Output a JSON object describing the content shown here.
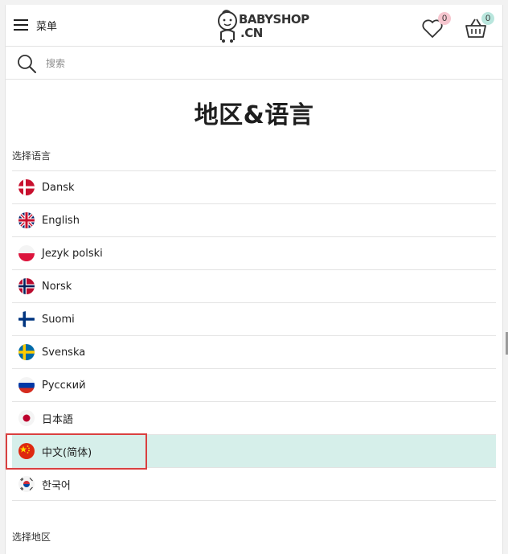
{
  "header": {
    "menu_label": "菜单",
    "logo_line1": "BABYSHOP",
    "logo_line2": ".CN",
    "wishlist_count": "0",
    "cart_count": "0",
    "wishlist_icon": "heart-icon",
    "cart_icon": "basket-icon"
  },
  "search": {
    "placeholder": "搜索",
    "icon": "search-icon"
  },
  "title": "地区&语言",
  "language_section": {
    "label": "选择语言",
    "items": [
      {
        "label": "Dansk",
        "flag": "flag-denmark-icon"
      },
      {
        "label": "English",
        "flag": "flag-uk-icon"
      },
      {
        "label": "Jezyk polski",
        "flag": "flag-poland-icon"
      },
      {
        "label": "Norsk",
        "flag": "flag-norway-icon"
      },
      {
        "label": "Suomi",
        "flag": "flag-finland-icon"
      },
      {
        "label": "Svenska",
        "flag": "flag-sweden-icon"
      },
      {
        "label": "Русский",
        "flag": "flag-russia-icon"
      },
      {
        "label": "日本語",
        "flag": "flag-japan-icon"
      },
      {
        "label": "中文(简体)",
        "flag": "flag-china-icon",
        "selected": true
      },
      {
        "label": "한국어",
        "flag": "flag-korea-icon"
      }
    ]
  },
  "region_section": {
    "label": "选择地区"
  },
  "colors": {
    "selected_row": "#d6efea",
    "wishlist_badge": "#f6c6cf",
    "cart_badge": "#b9e6dd",
    "highlight": "#d94040"
  }
}
